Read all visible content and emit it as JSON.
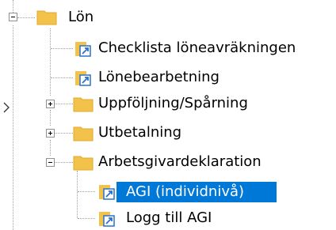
{
  "tree": {
    "root": {
      "label": "Lön"
    },
    "items": [
      {
        "label": "Checklista löneavräkningen"
      },
      {
        "label": "Lönebearbetning"
      },
      {
        "label": "Uppföljning/Spårning"
      },
      {
        "label": "Utbetalning"
      },
      {
        "label": "Arbetsgivardeklaration"
      }
    ],
    "sub_items": [
      {
        "label": "AGI (individnivå)"
      },
      {
        "label": "Logg till AGI"
      }
    ]
  },
  "colors": {
    "folder": "#f3c24b",
    "selection": "#0078d7",
    "doc_arrow": "#2a72c9"
  }
}
